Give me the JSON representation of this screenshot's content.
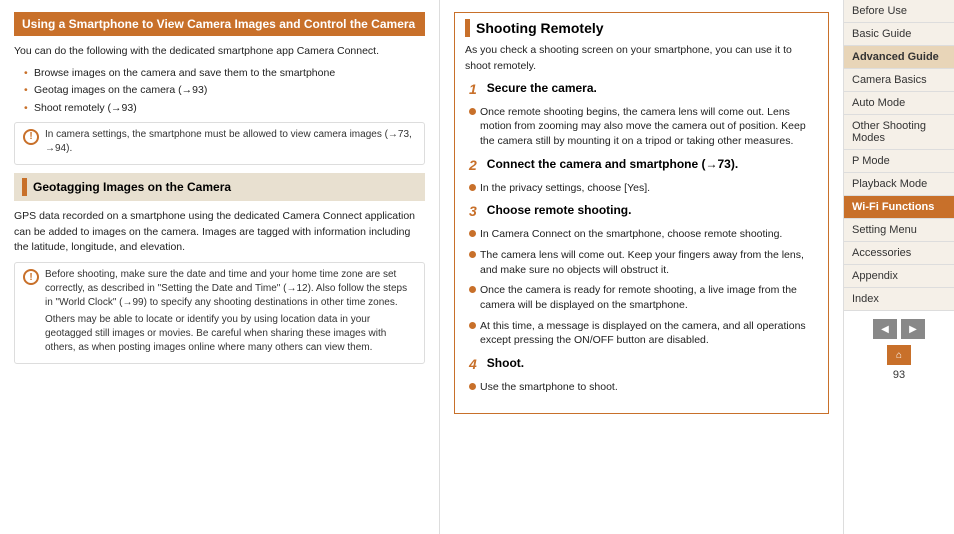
{
  "leftColumn": {
    "mainHeading": "Using a Smartphone to View Camera Images and Control the Camera",
    "mainBody": "You can do the following with the dedicated smartphone app Camera Connect.",
    "bullets": [
      "Browse images on the camera and save them to the smartphone",
      "Geotag images on the camera (→93)",
      "Shoot remotely (→93)"
    ],
    "note1": {
      "icon": "!",
      "items": [
        "In camera settings, the smartphone must be allowed to view camera images (→73, →94)."
      ]
    },
    "subHeading": "Geotagging Images on the Camera",
    "subBody": "GPS data recorded on a smartphone using the dedicated Camera Connect application can be added to images on the camera. Images are tagged with information including the latitude, longitude, and elevation.",
    "note2": {
      "icon": "!",
      "items": [
        "Before shooting, make sure the date and time and your home time zone are set correctly, as described in \"Setting the Date and Time\" (→12). Also follow the steps in \"World Clock\" (→99) to specify any shooting destinations in other time zones.",
        "Others may be able to locate or identify you by using location data in your geotagged still images or movies. Be careful when sharing these images with others, as when posting images online where many others can view them."
      ]
    }
  },
  "rightColumn": {
    "sectionTitle": "Shooting Remotely",
    "sectionIntro": "As you check a shooting screen on your smartphone, you can use it to shoot remotely.",
    "steps": [
      {
        "number": "1",
        "heading": "Secure the camera.",
        "bullets": [
          "Once remote shooting begins, the camera lens will come out. Lens motion from zooming may also move the camera out of position. Keep the camera still by mounting it on a tripod or taking other measures."
        ]
      },
      {
        "number": "2",
        "heading": "Connect the camera and smartphone (→73).",
        "bullets": [
          "In the privacy settings, choose [Yes]."
        ]
      },
      {
        "number": "3",
        "heading": "Choose remote shooting.",
        "bullets": [
          "In Camera Connect on the smartphone, choose remote shooting.",
          "The camera lens will come out. Keep your fingers away from the lens, and make sure no objects will obstruct it.",
          "Once the camera is ready for remote shooting, a live image from the camera will be displayed on the smartphone.",
          "At this time, a message is displayed on the camera, and all operations except pressing the ON/OFF button are disabled."
        ]
      },
      {
        "number": "4",
        "heading": "Shoot.",
        "bullets": [
          "Use the smartphone to shoot."
        ]
      }
    ]
  },
  "sidebar": {
    "items": [
      {
        "label": "Before Use",
        "active": false,
        "highlight": false
      },
      {
        "label": "Basic Guide",
        "active": false,
        "highlight": false
      },
      {
        "label": "Advanced Guide",
        "active": false,
        "highlight": true
      },
      {
        "label": "Camera Basics",
        "active": false,
        "highlight": false
      },
      {
        "label": "Auto Mode",
        "active": false,
        "highlight": false
      },
      {
        "label": "Other Shooting Modes",
        "active": false,
        "highlight": false
      },
      {
        "label": "P Mode",
        "active": false,
        "highlight": false
      },
      {
        "label": "Playback Mode",
        "active": false,
        "highlight": false
      },
      {
        "label": "Wi-Fi Functions",
        "active": true,
        "highlight": false
      },
      {
        "label": "Setting Menu",
        "active": false,
        "highlight": false
      },
      {
        "label": "Accessories",
        "active": false,
        "highlight": false
      },
      {
        "label": "Appendix",
        "active": false,
        "highlight": false
      },
      {
        "label": "Index",
        "active": false,
        "highlight": false
      }
    ],
    "prevLabel": "◀",
    "nextLabel": "▶",
    "homeLabel": "⌂",
    "pageNumber": "93"
  }
}
